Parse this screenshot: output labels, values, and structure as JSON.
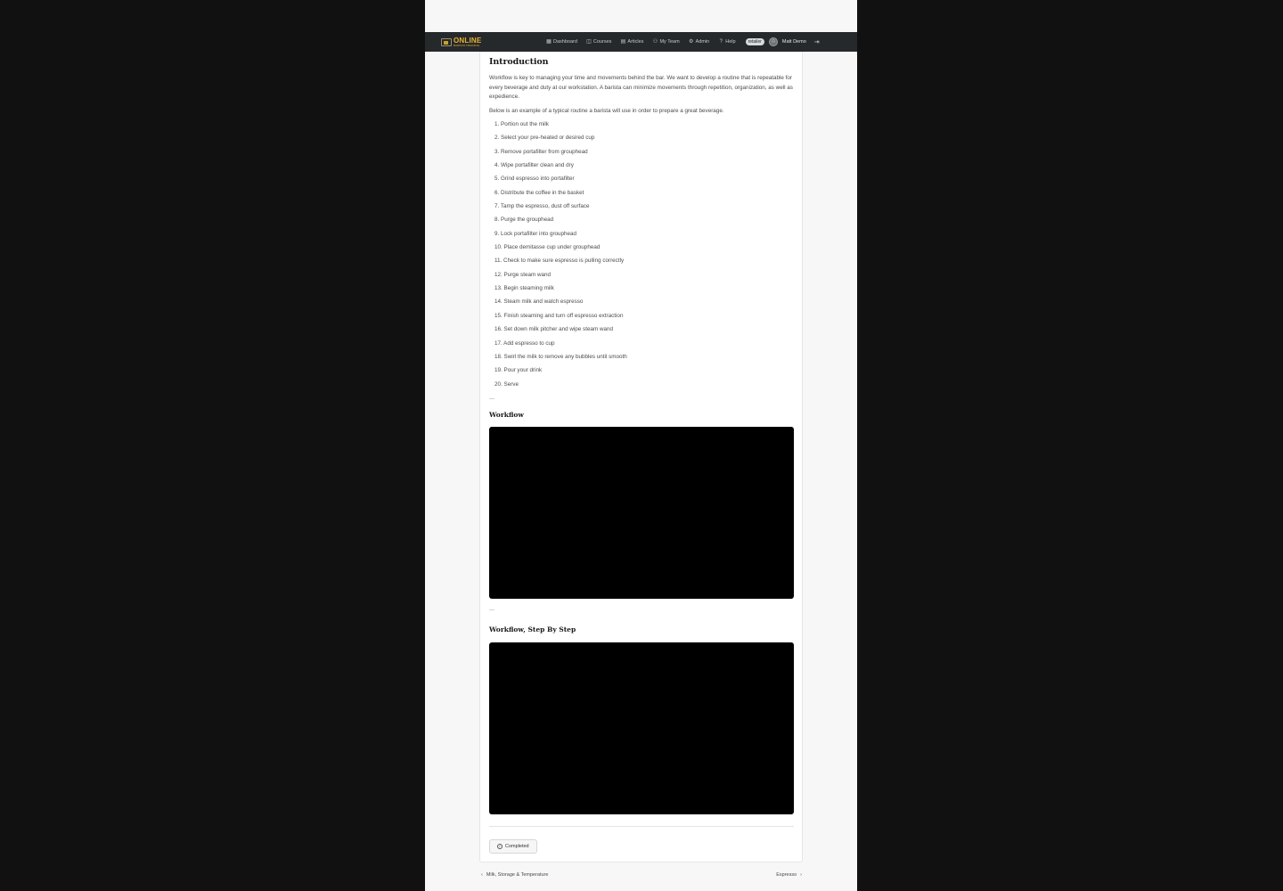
{
  "brand": {
    "logo_big": "ONLINE",
    "logo_small": "BARISTA TRAINING"
  },
  "nav": [
    {
      "label": "Dashboard",
      "icon": "grid-icon",
      "glyph": "▦"
    },
    {
      "label": "Courses",
      "icon": "book-icon",
      "glyph": "◫"
    },
    {
      "label": "Articles",
      "icon": "newspaper-icon",
      "glyph": "▤"
    },
    {
      "label": "My Team",
      "icon": "users-icon",
      "glyph": "⚇"
    },
    {
      "label": "Admin",
      "icon": "gear-icon",
      "glyph": "⚙"
    },
    {
      "label": "Help",
      "icon": "question-icon",
      "glyph": "?"
    }
  ],
  "user": {
    "badge": "retailer",
    "name": "Matt Demo",
    "logout_glyph": "⇥"
  },
  "content": {
    "heading": "Introduction",
    "paragraph1": "Workflow is key to managing your time and movements behind the bar. We want to develop a routine that is repeatable for every beverage and duty at our workstation. A barista can minimize movements through repetition, organization, as well as expedience.",
    "paragraph2": "Below is an example of a typical routine a barista will use in order to prepare a great beverage.",
    "steps": [
      "1. Portion out the milk",
      "2. Select your pre-heated or desired cup",
      "3. Remove portafilter from grouphead",
      "4. Wipe portafilter clean and dry",
      "5. Grind espresso into portafilter",
      "6. Distribute the coffee in the basket",
      "7. Tamp the espresso, dust off surface",
      "8. Purge the grouphead",
      "9. Lock portafilter into grouphead",
      "10. Place demitasse cup under grouphead",
      "11. Check to make sure espresso is pulling correctly",
      "12. Purge steam wand",
      "13. Begin steaming milk",
      "14. Steam milk and watch espresso",
      "15. Finish steaming and turn off espresso extraction",
      "16. Set down milk pitcher and wipe steam wand",
      "17. Add espresso to cup",
      "18. Swirl the milk to remove any bubbles until smooth",
      "19. Pour your drink",
      "20. Serve"
    ],
    "separator": "---",
    "section1_title": "Workflow",
    "section2_title": "Workflow, Step By Step",
    "completed_label": "Completed"
  },
  "footer": {
    "prev_label": "Milk, Storage & Temperature",
    "next_label": "Espresso"
  },
  "colors": {
    "topbar": "#26292c",
    "brand_gold": "#e6b12c",
    "video": "#000000"
  }
}
